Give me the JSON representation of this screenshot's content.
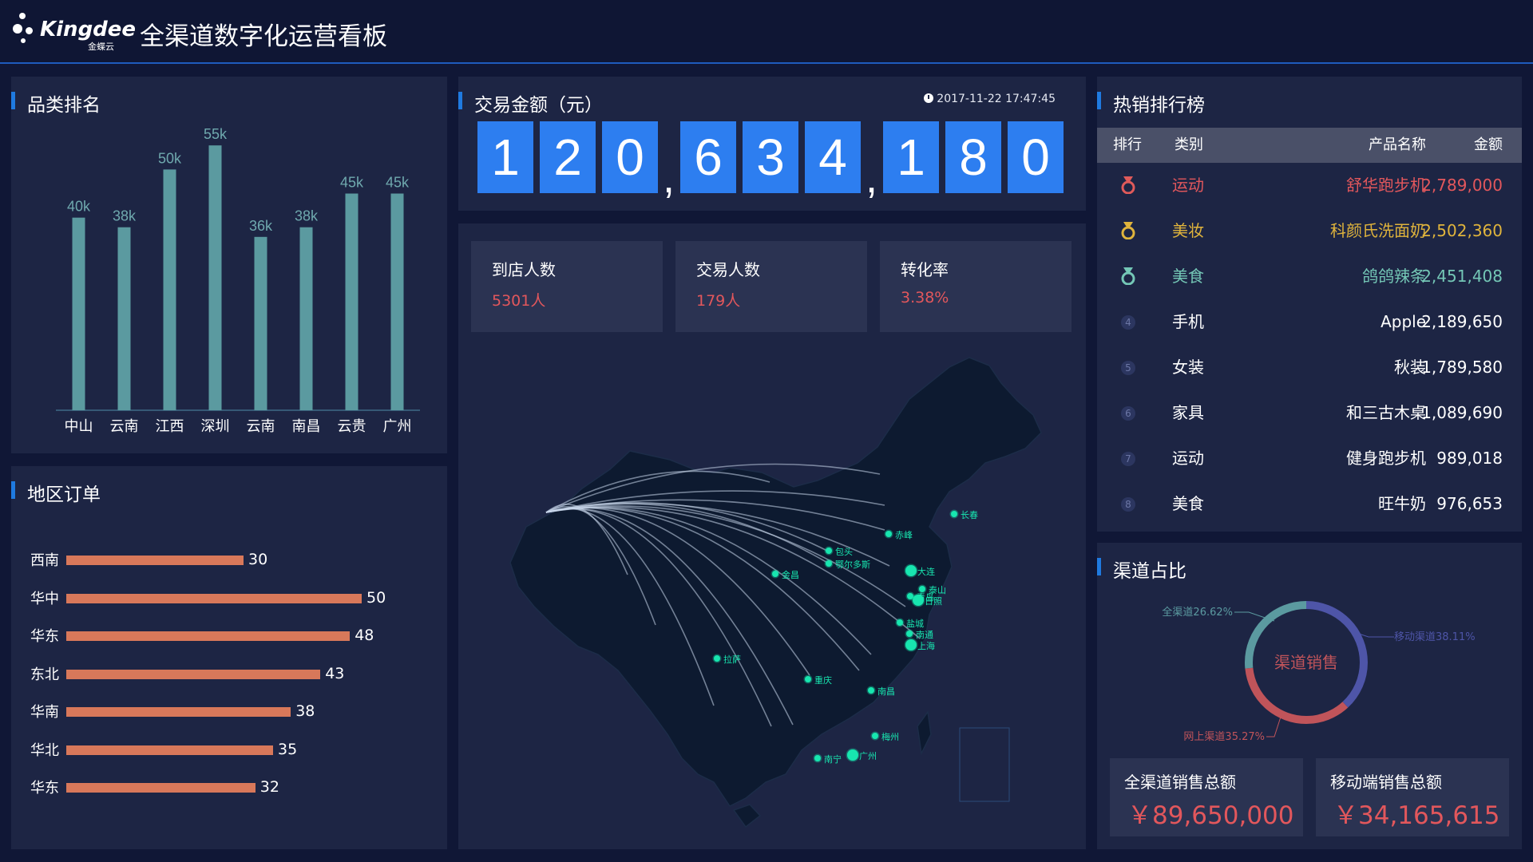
{
  "header": {
    "logo_text": "Kingdee",
    "logo_sub": "金蝶云",
    "title": "全渠道数字化运营看板"
  },
  "category_panel": {
    "title": "品类排名"
  },
  "region_panel": {
    "title": "地区订单"
  },
  "transaction_panel": {
    "title": "交易金额（元）",
    "timestamp": "2017-11-22 17:47:45",
    "digits": [
      "1",
      "2",
      "0",
      "6",
      "3",
      "4",
      "1",
      "8",
      "0"
    ],
    "amount_display": "120,634,180"
  },
  "stats": [
    {
      "label": "到店人数",
      "value": "5301人"
    },
    {
      "label": "交易人数",
      "value": "179人"
    },
    {
      "label": "转化率",
      "value": "3.38%"
    }
  ],
  "map": {
    "cities": [
      "长春",
      "赤峰",
      "包头",
      "鄂尔多斯",
      "大连",
      "金昌",
      "泰山",
      "日照",
      "青岛",
      "盐城",
      "南通",
      "上海",
      "拉萨",
      "重庆",
      "南昌",
      "梅州",
      "广州",
      "南宁"
    ]
  },
  "hot_panel": {
    "title": "热销排行榜",
    "columns": [
      "排行",
      "类别",
      "产品名称",
      "金额"
    ],
    "rows": [
      {
        "rank": "1",
        "medal": "gold-medal-icon",
        "category": "运动",
        "product": "舒华跑步机",
        "amount": "2,789,000",
        "color": "#e2575c"
      },
      {
        "rank": "2",
        "medal": "silver-medal-icon",
        "category": "美妆",
        "product": "科颜氏洗面奶",
        "amount": "2,502,360",
        "color": "#e0b43c"
      },
      {
        "rank": "3",
        "medal": "bronze-medal-icon",
        "category": "美食",
        "product": "鸽鸽辣条",
        "amount": "2,451,408",
        "color": "#74c7b6"
      },
      {
        "rank": "4",
        "category": "手机",
        "product": "Apple",
        "amount": "2,189,650",
        "color": "#ffffff"
      },
      {
        "rank": "5",
        "category": "女装",
        "product": "秋装",
        "amount": "1,789,580",
        "color": "#ffffff"
      },
      {
        "rank": "6",
        "category": "家具",
        "product": "和三古木桌",
        "amount": "1,089,690",
        "color": "#ffffff"
      },
      {
        "rank": "7",
        "category": "运动",
        "product": "健身跑步机",
        "amount": "989,018",
        "color": "#ffffff"
      },
      {
        "rank": "8",
        "category": "美食",
        "product": "旺牛奶",
        "amount": "976,653",
        "color": "#ffffff"
      }
    ]
  },
  "channel_panel": {
    "title": "渠道占比",
    "center_label": "渠道销售",
    "total_all_label": "全渠道销售总额",
    "total_all_value": "￥89,650,000",
    "total_mobile_label": "移动端销售总额",
    "total_mobile_value": "￥34,165,615"
  },
  "chart_data": [
    {
      "type": "bar",
      "categories": [
        "中山",
        "云南",
        "江西",
        "深圳",
        "云南",
        "南昌",
        "云贵",
        "广州"
      ],
      "values": [
        40,
        38,
        50,
        55,
        36,
        38,
        45,
        45
      ],
      "value_labels": [
        "40k",
        "38k",
        "50k",
        "55k",
        "36k",
        "38k",
        "45k",
        "45k"
      ],
      "ylim": [
        0,
        60
      ],
      "color": "#5b9aa0"
    },
    {
      "type": "bar",
      "orientation": "horizontal",
      "categories": [
        "西南",
        "华中",
        "华东",
        "东北",
        "华南",
        "华北",
        "华东"
      ],
      "values": [
        30,
        50,
        48,
        43,
        38,
        35,
        32
      ],
      "xlim": [
        0,
        50
      ],
      "color": "#d8785a"
    },
    {
      "type": "pie",
      "donut": true,
      "series": [
        {
          "name": "移动渠道",
          "value": 38.11,
          "label": "移动渠道38.11%",
          "color": "#4e55a8"
        },
        {
          "name": "网上渠道",
          "value": 35.27,
          "label": "网上渠道35.27%",
          "color": "#c0545a"
        },
        {
          "name": "全渠道",
          "value": 26.62,
          "label": "全渠道26.62%",
          "color": "#5b9aa0"
        }
      ]
    }
  ]
}
